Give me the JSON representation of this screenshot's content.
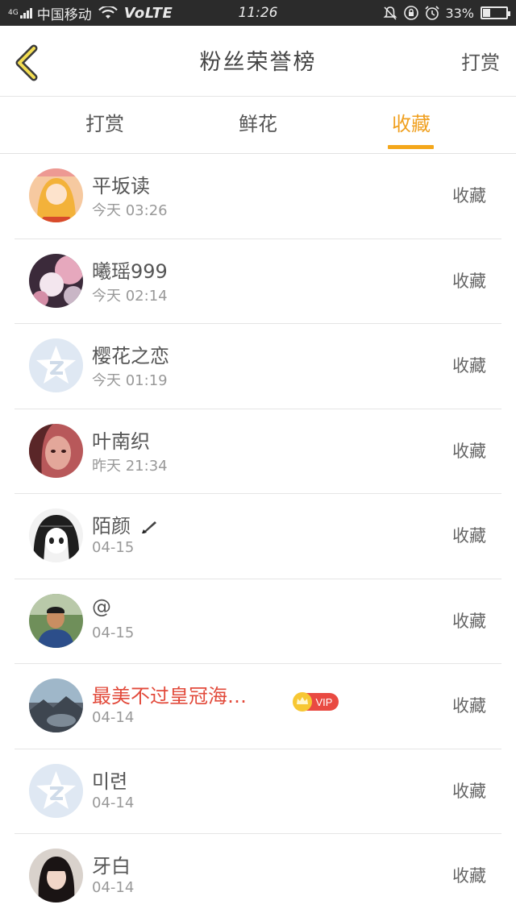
{
  "status_bar": {
    "network": "4G",
    "carrier": "中国移动",
    "volte": "VoLTE",
    "time": "11:26",
    "battery": "33%",
    "battery_level": 0.33
  },
  "header": {
    "title": "粉丝荣誉榜",
    "right_link": "打赏"
  },
  "tabs": [
    {
      "label": "打赏",
      "active": false
    },
    {
      "label": "鲜花",
      "active": false
    },
    {
      "label": "收藏",
      "active": true
    }
  ],
  "list": [
    {
      "name": "平坂读",
      "time": "今天 03:26",
      "action": "收藏",
      "avatar": "anime-girl-avatar"
    },
    {
      "name": "曦瑶999",
      "time": "今天 02:14",
      "action": "收藏",
      "avatar": "flower-photo-avatar"
    },
    {
      "name": "樱花之恋",
      "time": "今天 01:19",
      "action": "收藏",
      "avatar": "default-star-avatar"
    },
    {
      "name": "叶南织",
      "time": "昨天 21:34",
      "action": "收藏",
      "avatar": "girl-portrait-avatar"
    },
    {
      "name": "陌颜",
      "time": "04-15",
      "action": "收藏",
      "avatar": "manga-avatar"
    },
    {
      "name": "@",
      "time": "04-15",
      "action": "收藏",
      "avatar": "boy-photo-avatar"
    },
    {
      "name": "最美不过皇冠海…",
      "time": "04-14",
      "action": "收藏",
      "avatar": "landscape-avatar",
      "badge": "VIP"
    },
    {
      "name": "미련",
      "time": "04-14",
      "action": "收藏",
      "avatar": "default-star-avatar"
    },
    {
      "name": "牙白",
      "time": "04-14",
      "action": "收藏",
      "avatar": "girl-selfie-avatar"
    }
  ],
  "colors": {
    "accent": "#f4a71b",
    "vip_name": "#e24a3b",
    "status_bar": "#2b2b2b"
  }
}
